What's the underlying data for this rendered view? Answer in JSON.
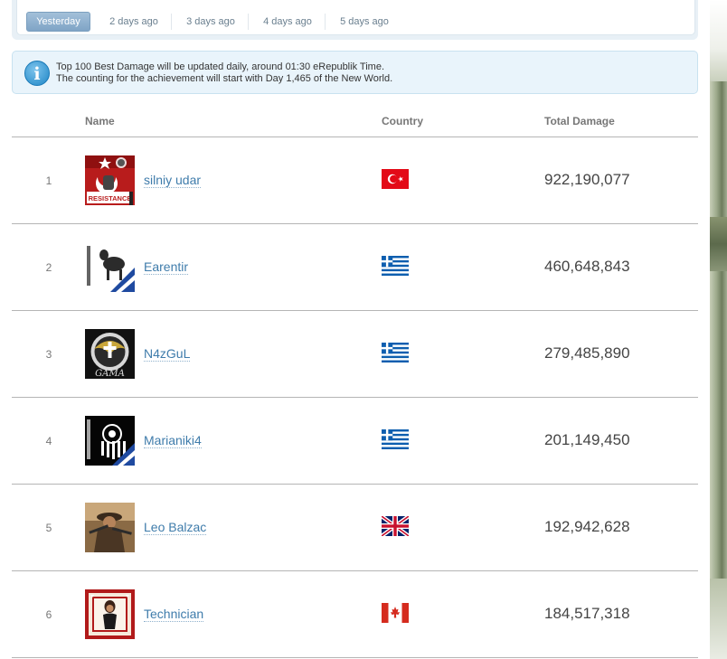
{
  "tabs": [
    {
      "label": "Yesterday",
      "active": true
    },
    {
      "label": "2 days ago",
      "active": false
    },
    {
      "label": "3 days ago",
      "active": false
    },
    {
      "label": "4 days ago",
      "active": false
    },
    {
      "label": "5 days ago",
      "active": false
    }
  ],
  "info": {
    "icon": "info-icon",
    "icon_glyph": "i",
    "line1": "Top 100 Best Damage will be updated daily, around 01:30 eRepublik Time.",
    "line2": "The counting for the achievement will start with Day 1,465 of the New World."
  },
  "table": {
    "headers": {
      "name": "Name",
      "country": "Country",
      "damage": "Total Damage"
    },
    "rows": [
      {
        "rank": "1",
        "name": "silniy udar",
        "country_flag": "turkey-flag",
        "damage": "922,190,077",
        "avatar_text": "RESISTANCE"
      },
      {
        "rank": "2",
        "name": "Earentir",
        "country_flag": "greece-flag",
        "damage": "460,648,843"
      },
      {
        "rank": "3",
        "name": "N4zGuL",
        "country_flag": "greece-flag",
        "damage": "279,485,890",
        "avatar_text": "GAMA"
      },
      {
        "rank": "4",
        "name": "Marianiki4",
        "country_flag": "greece-flag",
        "damage": "201,149,450"
      },
      {
        "rank": "5",
        "name": "Leo Balzac",
        "country_flag": "uk-flag",
        "damage": "192,942,628"
      },
      {
        "rank": "6",
        "name": "Technician",
        "country_flag": "canada-flag",
        "damage": "184,517,318"
      }
    ]
  },
  "colors": {
    "link": "#3f7cab",
    "active_tab": "#7fa4c6",
    "info_bg": "#e9f4fb"
  }
}
